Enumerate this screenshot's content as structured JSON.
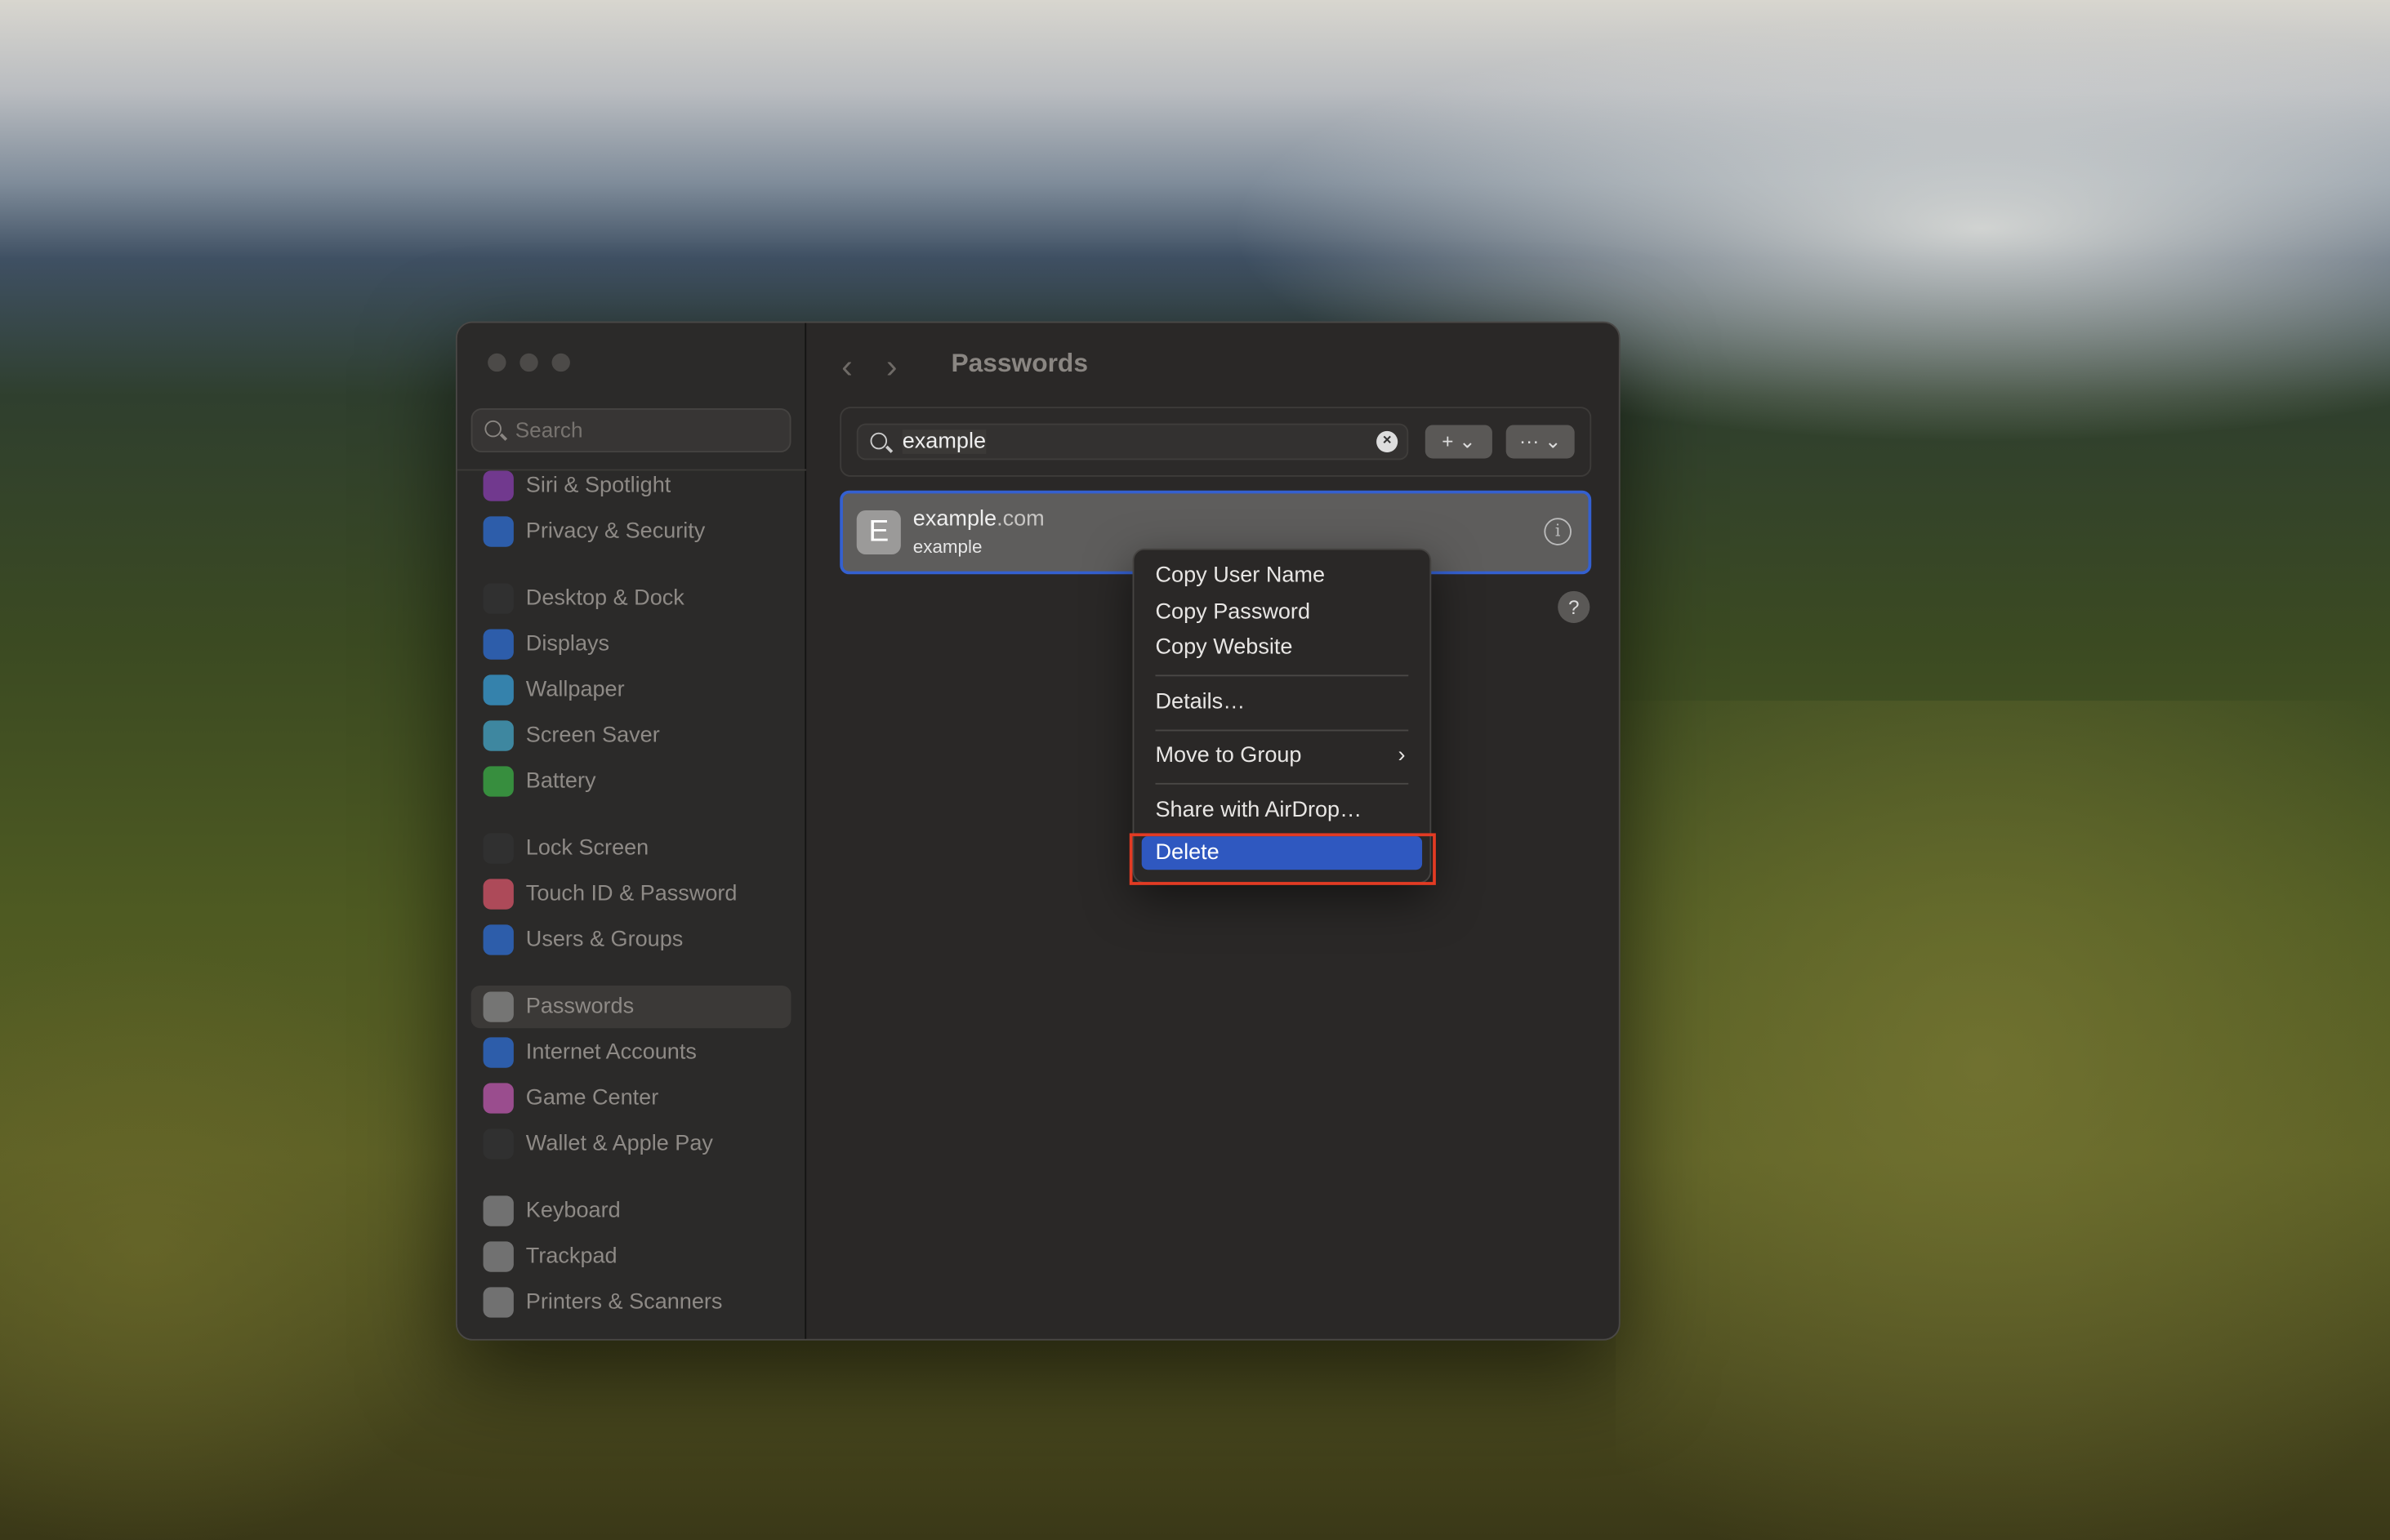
{
  "window": {
    "title": "Passwords"
  },
  "sidebar": {
    "search_placeholder": "Search",
    "items": [
      {
        "label": "Siri & Spotlight",
        "icon": "siri-icon",
        "color": "#8a3fb0"
      },
      {
        "label": "Privacy & Security",
        "icon": "hand-icon",
        "color": "#2f6fd6"
      },
      {
        "label": "Desktop & Dock",
        "icon": "desktop-icon",
        "color": "#333333"
      },
      {
        "label": "Displays",
        "icon": "sun-icon",
        "color": "#2f6fd6"
      },
      {
        "label": "Wallpaper",
        "icon": "flower-icon",
        "color": "#3aa0d8"
      },
      {
        "label": "Screen Saver",
        "icon": "screensaver-icon",
        "color": "#46a7c8"
      },
      {
        "label": "Battery",
        "icon": "battery-icon",
        "color": "#3cb046"
      },
      {
        "label": "Lock Screen",
        "icon": "lock-icon",
        "color": "#333333"
      },
      {
        "label": "Touch ID & Password",
        "icon": "fingerprint-icon",
        "color": "#d9566a"
      },
      {
        "label": "Users & Groups",
        "icon": "users-icon",
        "color": "#2f6fd6"
      },
      {
        "label": "Passwords",
        "icon": "key-icon",
        "color": "#8a8a8a",
        "selected": true
      },
      {
        "label": "Internet Accounts",
        "icon": "at-icon",
        "color": "#2f6fd6"
      },
      {
        "label": "Game Center",
        "icon": "game-center-icon",
        "color": "#c05ab0"
      },
      {
        "label": "Wallet & Apple Pay",
        "icon": "wallet-icon",
        "color": "#333333"
      },
      {
        "label": "Keyboard",
        "icon": "keyboard-icon",
        "color": "#8a8a8a"
      },
      {
        "label": "Trackpad",
        "icon": "trackpad-icon",
        "color": "#8a8a8a"
      },
      {
        "label": "Printers & Scanners",
        "icon": "printer-icon",
        "color": "#8a8a8a"
      }
    ]
  },
  "toolbar": {
    "search_value": "example",
    "add_label": "+ ⌄",
    "more_label": "··· ⌄"
  },
  "entry": {
    "initial": "E",
    "site_name": "example",
    "site_tld": ".com",
    "username": "example"
  },
  "help_label": "?",
  "context_menu": {
    "items": [
      "Copy User Name",
      "Copy Password",
      "Copy Website",
      "Details…",
      "Move to Group",
      "Share with AirDrop…",
      "Delete"
    ],
    "highlight_color": "#2f58c0",
    "annotation_color": "#e23b23"
  }
}
